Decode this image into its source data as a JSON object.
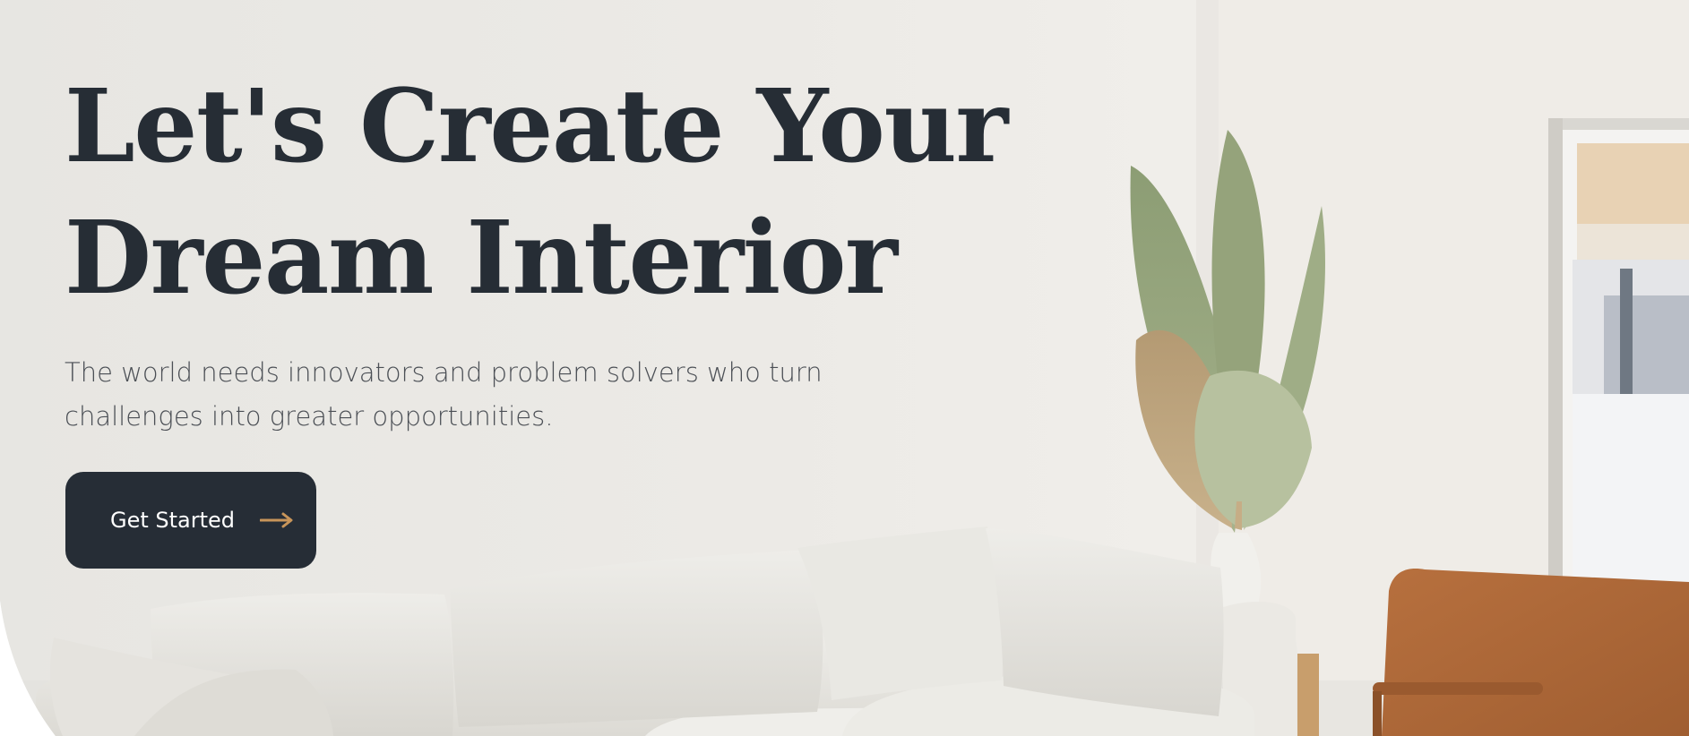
{
  "hero": {
    "title_line1": "Let's Create Your",
    "title_line2": "Dream Interior",
    "subtitle": "The world needs innovators and problem solvers who turn challenges into greater opportunities.",
    "cta_label": "Get Started",
    "cta_icon": "arrow-right-icon"
  },
  "colors": {
    "heading": "#262d35",
    "body_text": "#4b4f55",
    "button_bg": "#262d36",
    "accent": "#c8955a"
  }
}
